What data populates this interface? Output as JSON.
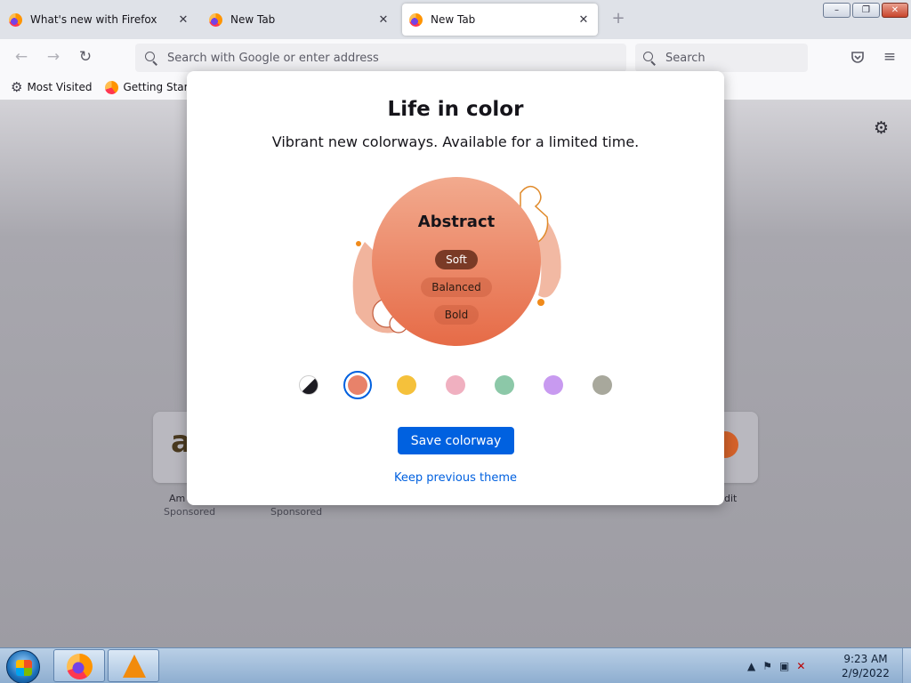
{
  "tabs": [
    {
      "label": "What's new with Firefox",
      "active": false
    },
    {
      "label": "New Tab",
      "active": false
    },
    {
      "label": "New Tab",
      "active": true
    }
  ],
  "window_controls": {
    "minimize": "–",
    "restore": "❐",
    "close": "✕"
  },
  "navbar": {
    "back_icon": "back-arrow-icon",
    "forward_icon": "forward-arrow-icon",
    "reload_icon": "reload-icon",
    "url_placeholder": "Search with Google or enter address",
    "search_placeholder": "Search",
    "pocket_icon": "pocket-icon",
    "menu_icon": "hamburger-menu-icon"
  },
  "bookmarks": [
    {
      "label": "Most Visited",
      "icon": "gear-icon"
    },
    {
      "label": "Getting Started",
      "icon": "firefox-icon"
    }
  ],
  "newtab": {
    "tiles": [
      {
        "label": "Am",
        "sponsored": "Sponsored"
      },
      {
        "label": "",
        "sponsored": "Sponsored"
      },
      {
        "label": "dit",
        "sponsored": ""
      }
    ]
  },
  "modal": {
    "title": "Life in color",
    "subtitle": "Vibrant new colorways. Available for a limited time.",
    "colorway_name": "Abstract",
    "intensity_options": [
      {
        "label": "Soft",
        "selected": true
      },
      {
        "label": "Balanced",
        "selected": false
      },
      {
        "label": "Bold",
        "selected": false
      }
    ],
    "swatches": [
      {
        "name": "default",
        "color": "#2b2a33",
        "selected": false
      },
      {
        "name": "abstract",
        "color": "#e8826a",
        "selected": true
      },
      {
        "name": "yellow",
        "color": "#f5c13b",
        "selected": false
      },
      {
        "name": "pink",
        "color": "#f0b0c0",
        "selected": false
      },
      {
        "name": "green",
        "color": "#8cc8a8",
        "selected": false
      },
      {
        "name": "purple",
        "color": "#c89af0",
        "selected": false
      },
      {
        "name": "gray",
        "color": "#a8a89c",
        "selected": false
      }
    ],
    "save_label": "Save colorway",
    "keep_label": "Keep previous theme"
  },
  "taskbar": {
    "apps": [
      "firefox",
      "vlc"
    ],
    "time": "9:23 AM",
    "date": "2/9/2022"
  },
  "colors": {
    "accent": "#0061e0",
    "link": "#0060df",
    "colorway_gradient_top": "#f2aa8e",
    "colorway_gradient_bottom": "#e66b47"
  }
}
